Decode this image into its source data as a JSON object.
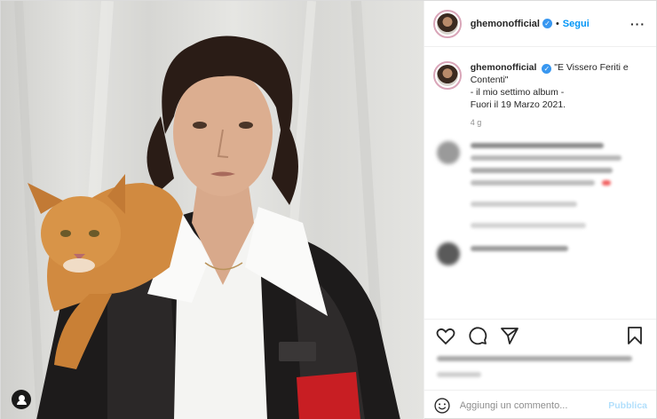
{
  "post": {
    "username": "ghemonofficial",
    "follow_label": "Segui",
    "dot": "•",
    "more_icon": "more-horizontal-icon",
    "caption_lines": [
      "\"E Vissero Feriti e Contenti\"",
      "- il mio settimo album -",
      "Fuori il 19 Marzo 2021."
    ],
    "age": "4 g"
  },
  "actions": {
    "like_icon": "heart-icon",
    "comment_icon": "comment-icon",
    "share_icon": "paper-plane-icon",
    "save_icon": "bookmark-icon"
  },
  "add_comment": {
    "placeholder": "Aggiungi un commento...",
    "publish_label": "Pubblica",
    "emoji_icon": "emoji-icon"
  },
  "colors": {
    "accent": "#0095f6",
    "verified": "#3897f0",
    "publish_disabled": "#b2dffc"
  }
}
